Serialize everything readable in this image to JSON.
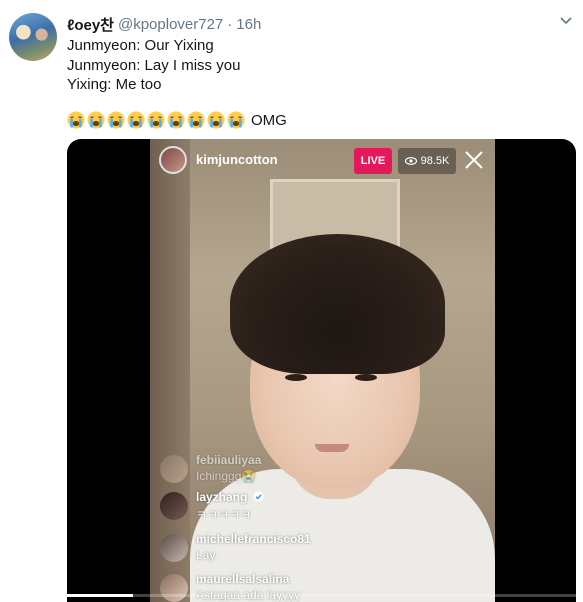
{
  "tweet": {
    "display_name": "ℓoey찬",
    "username": "@kpoplover727",
    "separator": "·",
    "time": "16h",
    "lines": [
      "Junmyeon: Our Yixing",
      "Junmyeon: Lay I miss you",
      "Yixing: Me too"
    ],
    "emoji_count": 9,
    "emoji_name": "loudly-crying-face",
    "emoji_suffix": "OMG"
  },
  "video": {
    "host_name": "kimjuncotton",
    "live_label": "LIVE",
    "viewer_count": "98.5K",
    "progress_fraction": 0.13,
    "comments": [
      {
        "user": "febiiauliyaa",
        "text": "Ichinggg😭",
        "faded": true
      },
      {
        "user": "layzhang",
        "text": "ㅋㅋㅋㅋㅋ",
        "verified": true,
        "faded": false
      },
      {
        "user": "michellefrancisco81",
        "text": "Lay",
        "faded": false
      },
      {
        "user": "maurellsalsalina",
        "text": "Astagaa ada layyyy",
        "faded": false
      }
    ]
  },
  "colors": {
    "live_badge": "#e3195c",
    "secondary_text": "#657786",
    "emoji_yellow": "#ffcc4d",
    "emoji_tears": "#5dadec"
  }
}
